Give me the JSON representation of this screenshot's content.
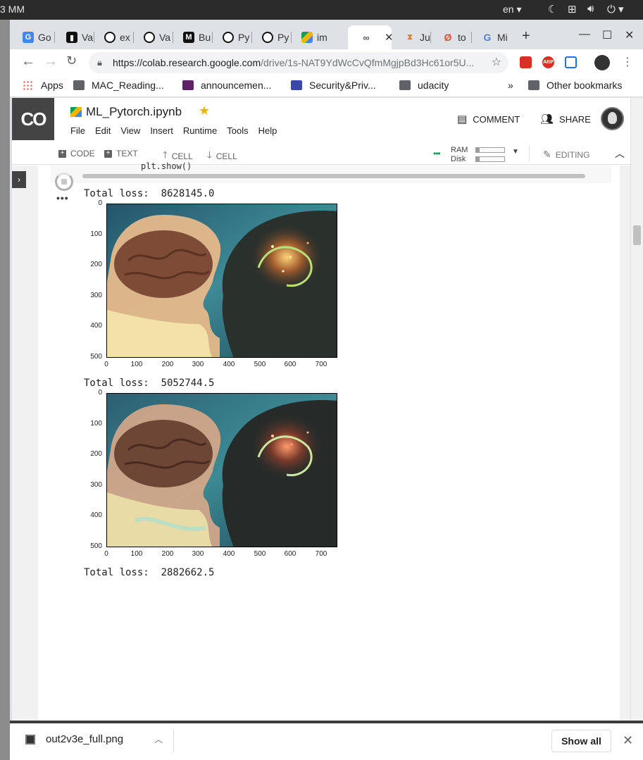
{
  "os": {
    "clock": "3 MM",
    "language": "en"
  },
  "tabs": [
    {
      "label": "Go",
      "icon": "google-docs-icon"
    },
    {
      "label": "Va",
      "icon": "chart-icon"
    },
    {
      "label": "ex",
      "icon": "github-icon"
    },
    {
      "label": "Va",
      "icon": "github-icon"
    },
    {
      "label": "Bu",
      "icon": "medium-icon"
    },
    {
      "label": "Py",
      "icon": "github-icon"
    },
    {
      "label": "Py",
      "icon": "github-icon"
    },
    {
      "label": "im",
      "icon": "google-drive-icon"
    },
    {
      "label": "",
      "icon": "colab-icon",
      "active": true
    },
    {
      "label": "Ju",
      "icon": "jupyter-icon"
    },
    {
      "label": "to",
      "icon": "pytorch-icon"
    },
    {
      "label": "Mi",
      "icon": "google-icon"
    }
  ],
  "address": {
    "host": "https://colab.research.google.com",
    "path": "/drive/1s-NAT9YdWcCvQfmMgjpBd3Hc61or5U..."
  },
  "bookmarks": [
    {
      "label": "Apps"
    },
    {
      "label": "MAC_Reading..."
    },
    {
      "label": "announcemen..."
    },
    {
      "label": "Security&Priv..."
    },
    {
      "label": "udacity"
    }
  ],
  "bookmarks_more": "»",
  "other_bookmarks": "Other bookmarks",
  "colab": {
    "logo": "CO",
    "title": "ML_Pytorch.ipynb",
    "menu": [
      "File",
      "Edit",
      "View",
      "Insert",
      "Runtime",
      "Tools",
      "Help"
    ],
    "comment": "COMMENT",
    "share": "SHARE"
  },
  "nb_toolbar": {
    "code": "CODE",
    "text": "TEXT",
    "cell_up": "CELL",
    "cell_down": "CELL",
    "ram": "RAM",
    "disk": "Disk",
    "editing": "EDITING"
  },
  "cell": {
    "code_fragment": "plt.show()"
  },
  "output": {
    "losses": [
      "Total loss:  8628145.0",
      "Total loss:  5052744.5",
      "Total loss:  2882662.5"
    ],
    "yticks": [
      "0",
      "100",
      "200",
      "300",
      "400",
      "500"
    ],
    "xticks": [
      "0",
      "100",
      "200",
      "300",
      "400",
      "500",
      "600",
      "700"
    ]
  },
  "download": {
    "filename": "out2v3e_full.png",
    "show_all": "Show all"
  }
}
